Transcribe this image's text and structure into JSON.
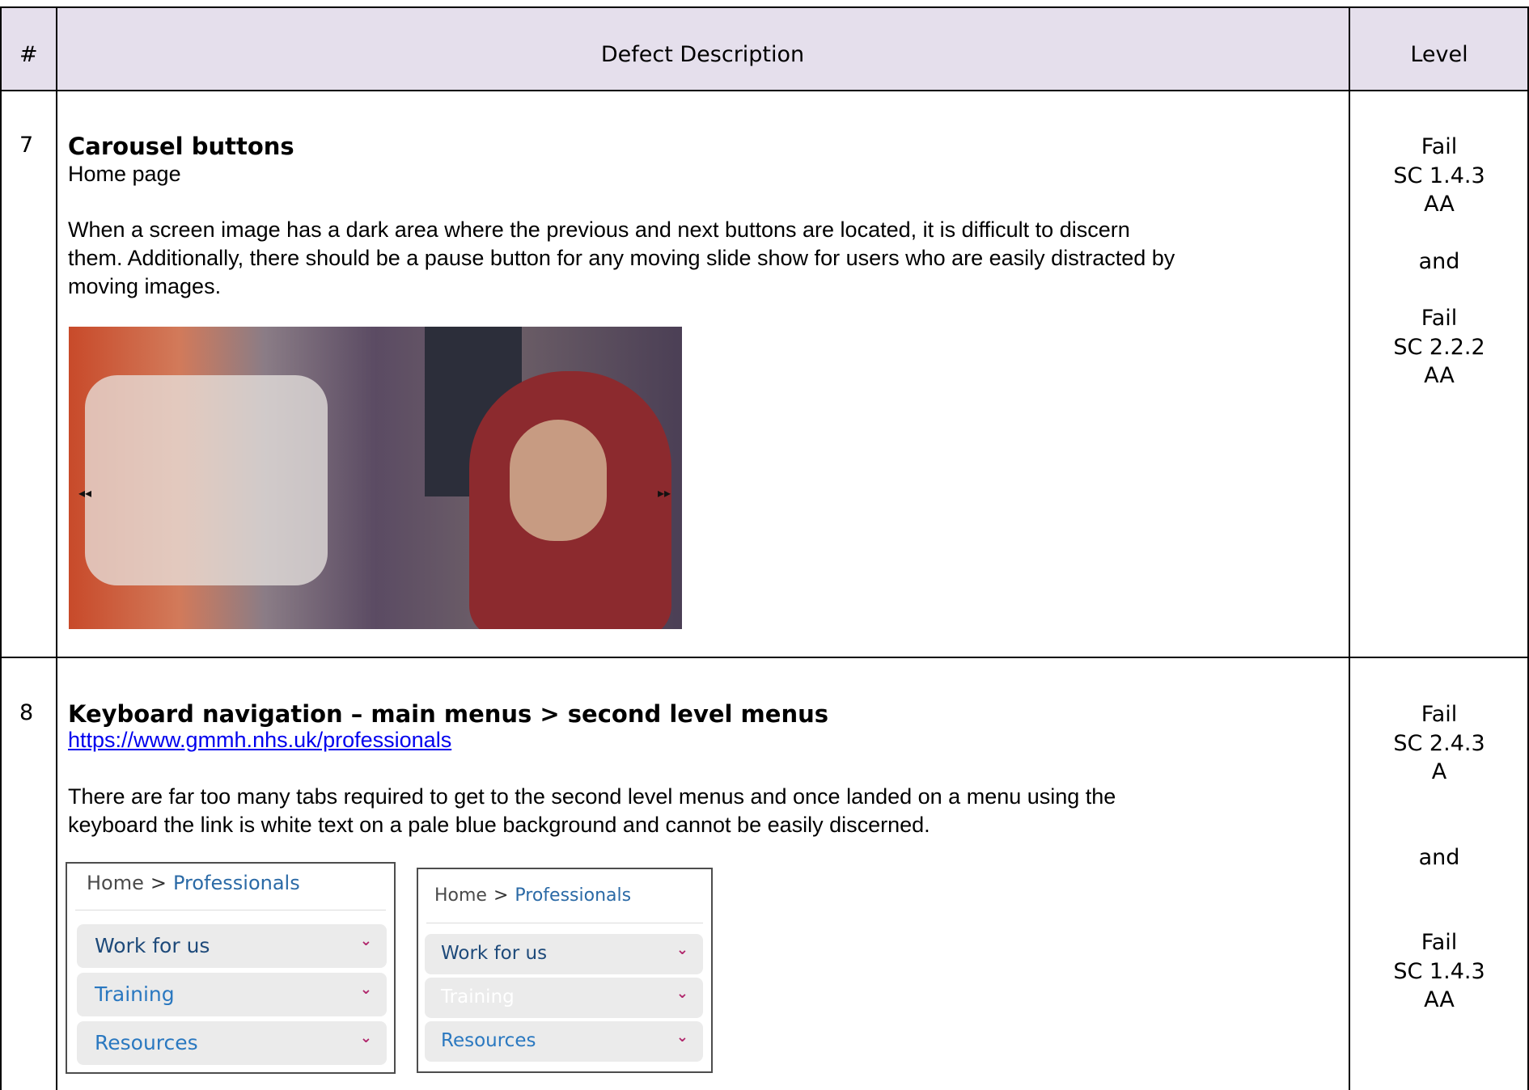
{
  "header": {
    "num": "#",
    "description": "Defect Description",
    "level": "Level"
  },
  "rows": [
    {
      "num": "7",
      "title": "Carousel buttons",
      "location": "Home page",
      "description_lines": [
        "When a screen image has a dark area where the previous and next buttons are located, it is difficult to discern",
        "them. Additionally, there should be a pause button for any moving slide show for users who are easily distracted by",
        "moving images."
      ],
      "levels": {
        "fail1": "Fail",
        "sc1": "SC 1.4.3",
        "lvl1": "AA",
        "and": "and",
        "fail2": "Fail",
        "sc2": "SC 2.2.2",
        "lvl2": "AA"
      },
      "carousel": {
        "prev_icon": "◂◂",
        "next_icon": "▸▸"
      }
    },
    {
      "num": "8",
      "title": "Keyboard navigation – main menus > second level menus",
      "url": "https://www.gmmh.nhs.uk/professionals",
      "description_lines": [
        "There are far too many tabs required to get to the second level menus and once landed on a menu using the",
        "keyboard the link is white text on a pale blue background and cannot be easily discerned."
      ],
      "levels": {
        "fail1": "Fail",
        "sc1": "SC 2.4.3",
        "lvl1": "A",
        "and": "and",
        "fail2": "Fail",
        "sc2": "SC 1.4.3",
        "lvl2": "AA"
      },
      "menu_left": {
        "home": "Home",
        "sep": ">",
        "current": "Professionals",
        "items": [
          "Work for us",
          "Training",
          "Resources"
        ],
        "chevron": "⌄"
      },
      "menu_right": {
        "home": "Home",
        "sep": ">",
        "current": "Professionals",
        "items": [
          "Work for us",
          "Training",
          "Resources"
        ],
        "chevron": "⌄"
      }
    }
  ]
}
